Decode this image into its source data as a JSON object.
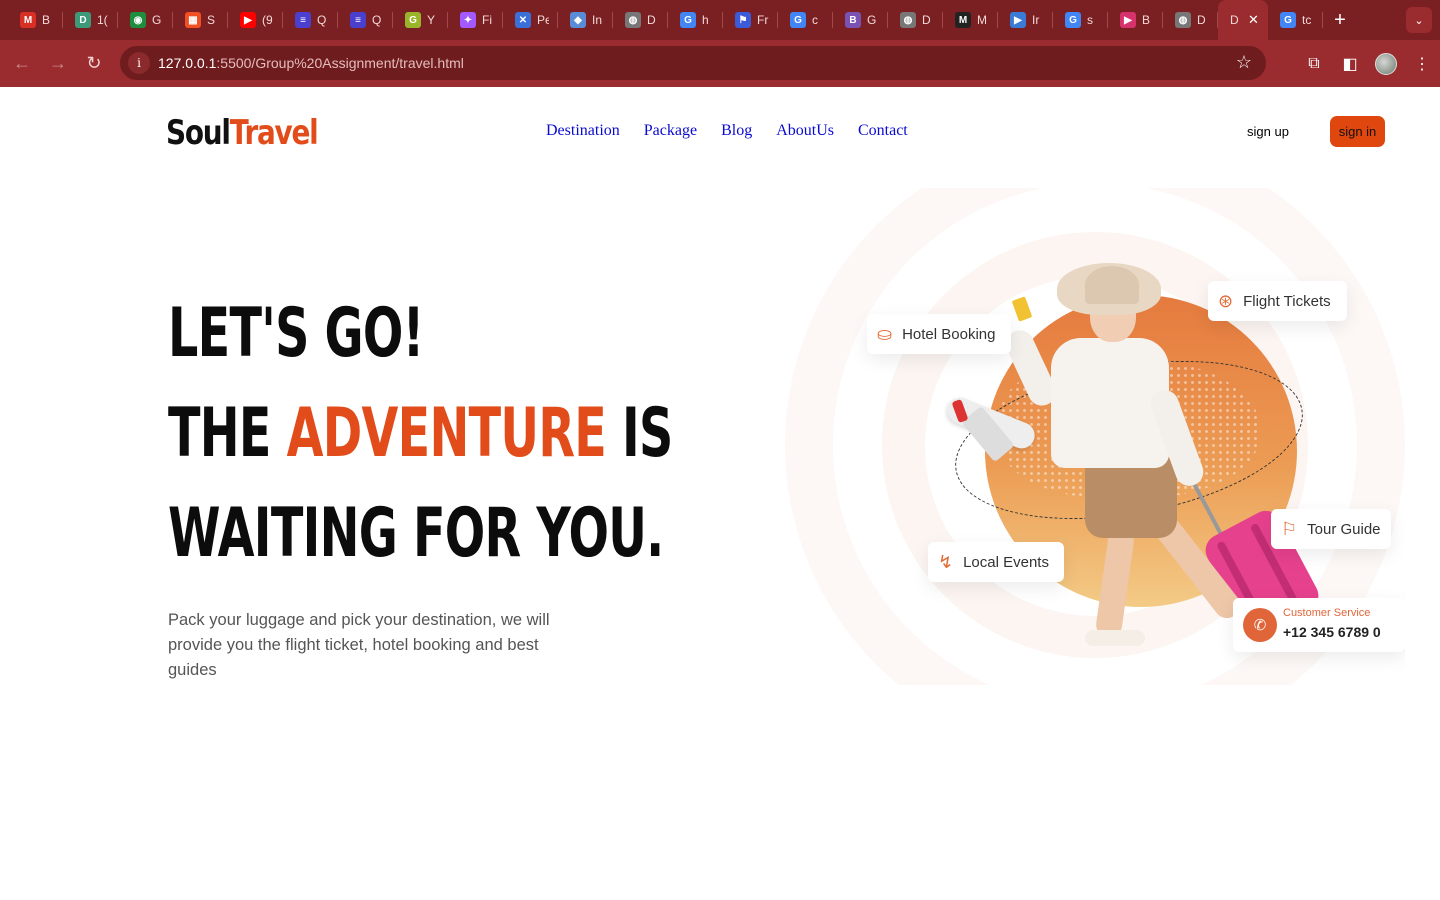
{
  "browser": {
    "tabs": [
      {
        "icon": "gmail-icon",
        "title": "B",
        "color": "#d93025",
        "glyph": "M"
      },
      {
        "icon": "d-icon",
        "title": "1(",
        "color": "#3c9a7a",
        "glyph": "D"
      },
      {
        "icon": "meet-icon",
        "title": "G",
        "color": "#1e8e3e",
        "glyph": "◉"
      },
      {
        "icon": "microsoft-icon",
        "title": "S",
        "color": "#f25022",
        "glyph": "▦"
      },
      {
        "icon": "youtube-icon",
        "title": "(9",
        "color": "#ff0000",
        "glyph": "▶"
      },
      {
        "icon": "list-icon",
        "title": "Q",
        "color": "#4b3fcf",
        "glyph": "≡"
      },
      {
        "icon": "list-icon",
        "title": "Q",
        "color": "#4b3fcf",
        "glyph": "≡"
      },
      {
        "icon": "g-icon",
        "title": "Y",
        "color": "#9bb52a",
        "glyph": "G"
      },
      {
        "icon": "figma-icon",
        "title": "Fi",
        "color": "#a259ff",
        "glyph": "✦"
      },
      {
        "icon": "pexels-icon",
        "title": "Pe",
        "color": "#3a6fd8",
        "glyph": "✕"
      },
      {
        "icon": "box-icon",
        "title": "In",
        "color": "#5a8bd6",
        "glyph": "◆"
      },
      {
        "icon": "globe-icon",
        "title": "D",
        "color": "#777777",
        "glyph": "◍"
      },
      {
        "icon": "google-icon",
        "title": "h",
        "color": "#4285f4",
        "glyph": "G"
      },
      {
        "icon": "flag-icon",
        "title": "Fr",
        "color": "#3b5bd8",
        "glyph": "⚑"
      },
      {
        "icon": "google-icon",
        "title": "c",
        "color": "#4285f4",
        "glyph": "G"
      },
      {
        "icon": "bootstrap-icon",
        "title": "G",
        "color": "#7952b3",
        "glyph": "B"
      },
      {
        "icon": "globe-icon",
        "title": "D",
        "color": "#777777",
        "glyph": "◍"
      },
      {
        "icon": "m-icon",
        "title": "M",
        "color": "#222222",
        "glyph": "M"
      },
      {
        "icon": "play-icon",
        "title": "Ir",
        "color": "#3a7bd5",
        "glyph": "▶"
      },
      {
        "icon": "google-icon",
        "title": "s",
        "color": "#4285f4",
        "glyph": "G"
      },
      {
        "icon": "play-icon",
        "title": "B",
        "color": "#d6336c",
        "glyph": "▶"
      },
      {
        "icon": "globe-icon",
        "title": "D",
        "color": "#777777",
        "glyph": "◍"
      }
    ],
    "active_tab": {
      "title": "D",
      "close": "✕"
    },
    "last_tab": {
      "icon": "google-icon",
      "title": "tc",
      "color": "#4285f4",
      "glyph": "G"
    },
    "new_tab": "+",
    "tab_search": "⌄",
    "url_host": "127.0.0.1",
    "url_path": ":5500/Group%20Assignment/travel.html"
  },
  "site": {
    "logo_soul": "Soul",
    "logo_travel": "Travel",
    "nav": [
      "Destination",
      "Package",
      "Blog",
      "AboutUs",
      "Contact"
    ],
    "signup": "sign up",
    "signin": "sign in",
    "headline": {
      "line1": "LET'S GO!",
      "line2_a": "THE ",
      "line2_accent": "ADVENTURE",
      "line2_b": " IS",
      "line3": "WAITING FOR YOU."
    },
    "subtitle": "Pack your luggage and pick your destination, we will provide you the flight ticket, hotel booking and best guides",
    "badges": {
      "hotel": "Hotel Booking",
      "flight": "Flight Tickets",
      "tour": "Tour Guide",
      "events": "Local Events"
    },
    "customer_service": {
      "label": "Customer Service",
      "phone": "+12 345 6789 0"
    },
    "colors": {
      "accent": "#e24c1a",
      "nav_link": "#0b0bd0",
      "chrome": "#9a2b2e"
    }
  }
}
